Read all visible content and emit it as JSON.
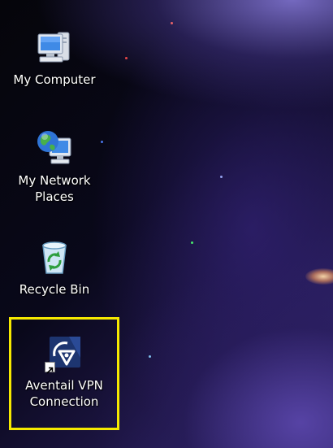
{
  "desktop": {
    "icons": [
      {
        "label": "My Computer",
        "icon": "my-computer-icon"
      },
      {
        "label": "My Network Places",
        "icon": "network-places-icon"
      },
      {
        "label": "Recycle Bin",
        "icon": "recycle-bin-icon"
      },
      {
        "label": "Aventail VPN Connection",
        "icon": "vpn-connection-icon",
        "shortcut": true,
        "selected": true
      }
    ],
    "colors": {
      "selection_highlight": "#f6e900",
      "label_text": "#ffffff",
      "vpn_icon_background": "#1d3570"
    }
  }
}
